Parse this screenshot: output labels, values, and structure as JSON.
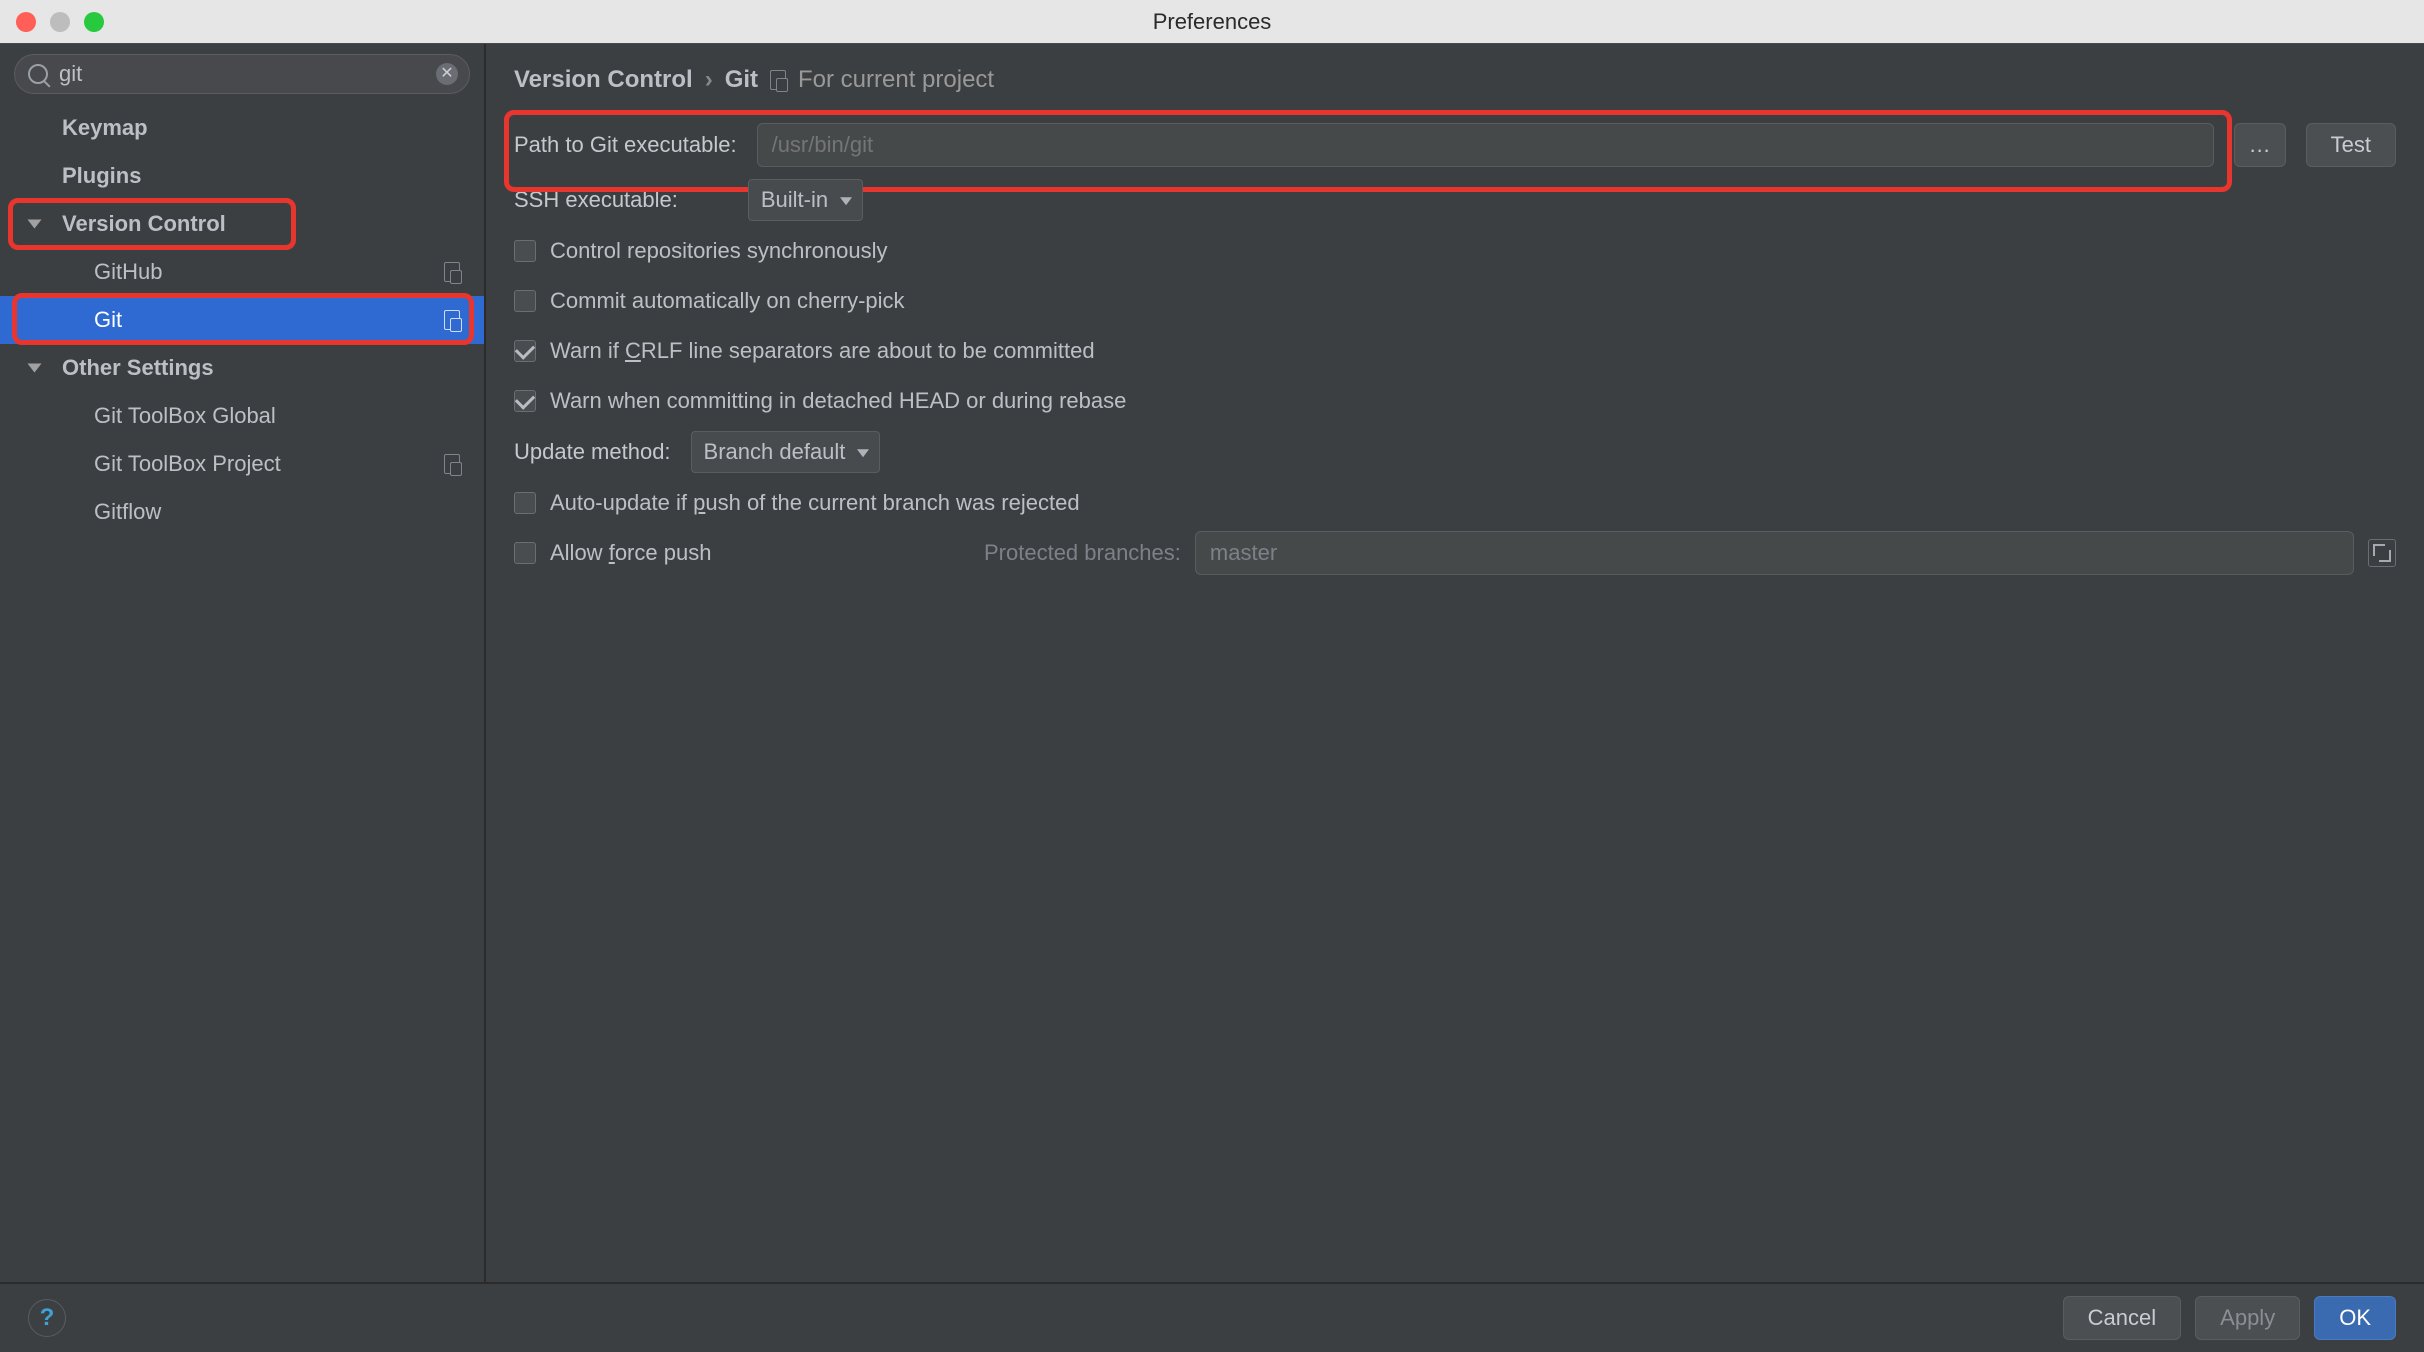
{
  "window": {
    "title": "Preferences"
  },
  "sidebar": {
    "search_value": "git",
    "items": [
      {
        "label": "Keymap"
      },
      {
        "label": "Plugins"
      },
      {
        "label": "Version Control",
        "expandable": true
      },
      {
        "label": "GitHub",
        "badge": true
      },
      {
        "label": "Git",
        "badge": true,
        "selected": true
      },
      {
        "label": "Other Settings",
        "expandable": true
      },
      {
        "label": "Git ToolBox Global"
      },
      {
        "label": "Git ToolBox Project",
        "badge": true
      },
      {
        "label": "Gitflow"
      }
    ]
  },
  "breadcrumb": {
    "root": "Version Control",
    "leaf": "Git",
    "hint": "For current project"
  },
  "form": {
    "path_label": "Path to Git executable:",
    "path_placeholder": "/usr/bin/git",
    "test_label": "Test",
    "ssh_label": "SSH executable:",
    "ssh_value": "Built-in",
    "opt_sync": "Control repositories synchronously",
    "opt_cherry": "Commit automatically on cherry-pick",
    "opt_crlf_pre": "Warn if ",
    "opt_crlf_u": "C",
    "opt_crlf_post": "RLF line separators are about to be committed",
    "opt_detached": "Warn when committing in detached HEAD or during rebase",
    "update_label": "Update method:",
    "update_value": "Branch default",
    "opt_auto_pre": "Auto-update if ",
    "opt_auto_u": "p",
    "opt_auto_post": "ush of the current branch was rejected",
    "opt_force_pre": "Allow ",
    "opt_force_u": "f",
    "opt_force_post": "orce push",
    "protected_label": "Protected branches:",
    "protected_value": "master"
  },
  "footer": {
    "cancel": "Cancel",
    "apply": "Apply",
    "ok": "OK"
  }
}
